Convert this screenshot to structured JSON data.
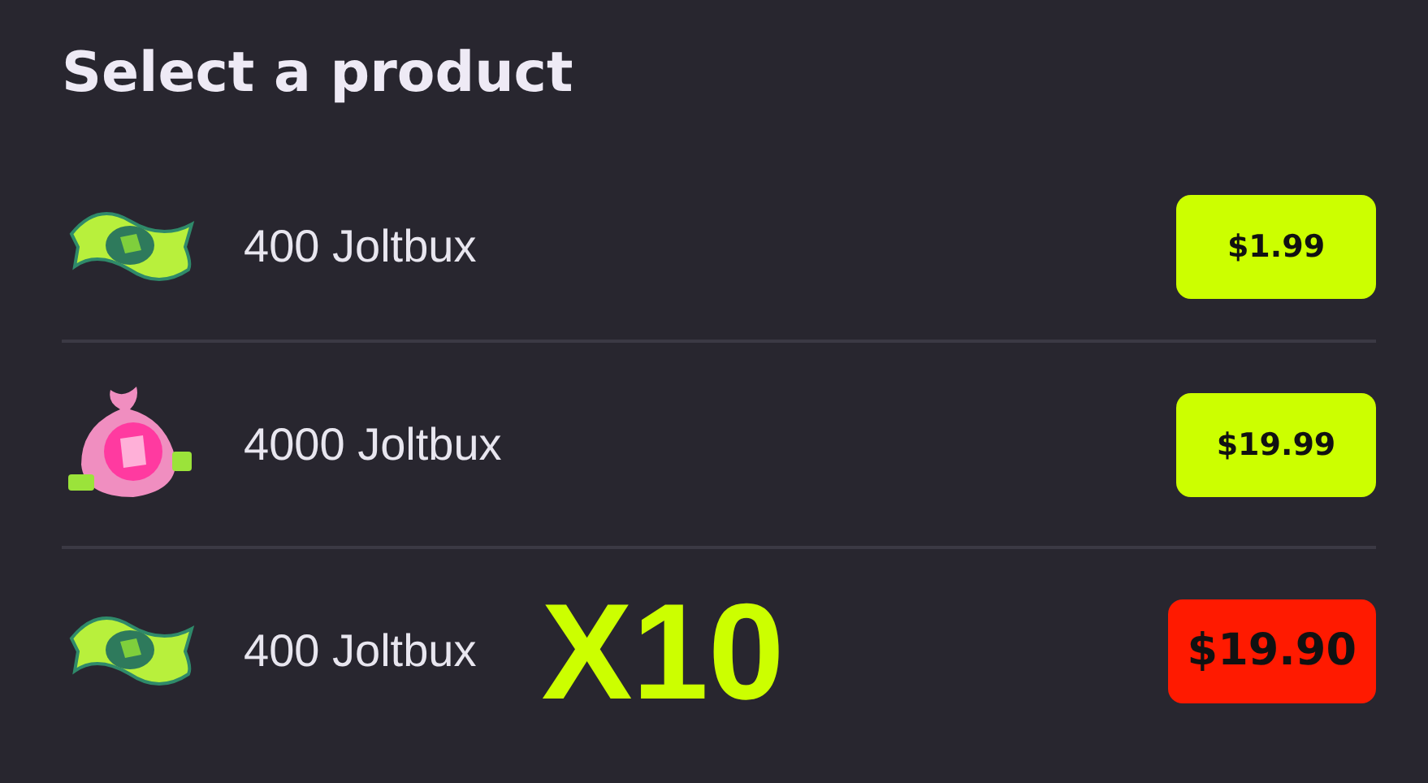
{
  "title": "Select a product",
  "products": [
    {
      "kind": "bill",
      "label": "400 Joltbux",
      "price": "$1.99",
      "color": "#ccff00"
    },
    {
      "kind": "bag",
      "label": "4000 Joltbux",
      "price": "$19.99",
      "color": "#ccff00"
    },
    {
      "kind": "bill",
      "label": "400 Joltbux",
      "multiplier": "X10",
      "price": "$19.90",
      "color": "#ff1a00"
    }
  ]
}
